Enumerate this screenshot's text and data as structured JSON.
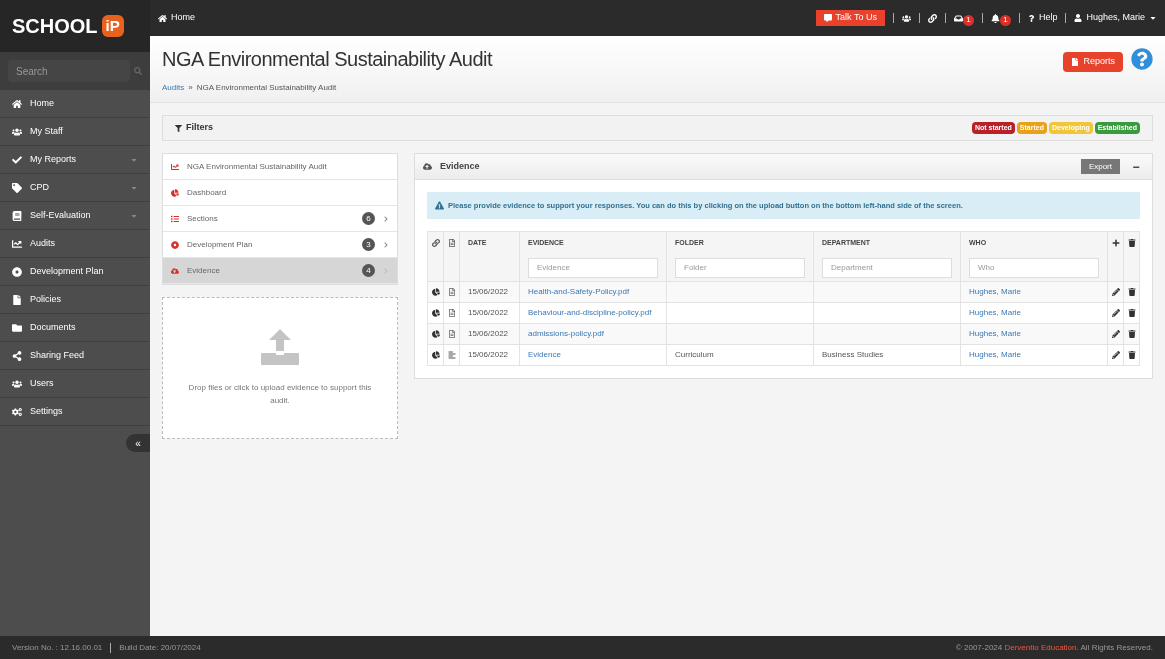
{
  "brand": {
    "name": "SCHOOL",
    "mark": "iP"
  },
  "topbar": {
    "home": "Home",
    "talk": "Talk To Us",
    "messages_count": "1",
    "alerts_count": "1",
    "help": "Help",
    "user": "Hughes, Marie"
  },
  "sidebar": {
    "search_placeholder": "Search",
    "items": [
      {
        "label": "Home",
        "has_caret": false
      },
      {
        "label": "My Staff",
        "has_caret": false
      },
      {
        "label": "My Reports",
        "has_caret": true
      },
      {
        "label": "CPD",
        "has_caret": true
      },
      {
        "label": "Self-Evaluation",
        "has_caret": true
      },
      {
        "label": "Audits",
        "has_caret": false
      },
      {
        "label": "Development Plan",
        "has_caret": false
      },
      {
        "label": "Policies",
        "has_caret": false
      },
      {
        "label": "Documents",
        "has_caret": false
      },
      {
        "label": "Sharing Feed",
        "has_caret": false
      },
      {
        "label": "Users",
        "has_caret": false
      },
      {
        "label": "Settings",
        "has_caret": false
      }
    ],
    "collapse": "«"
  },
  "page": {
    "title": "NGA Environmental Sustainability Audit",
    "breadcrumb": {
      "link": "Audits",
      "sep": "»",
      "current": "NGA Environmental Sustainability Audit"
    },
    "reports": "Reports"
  },
  "filters": {
    "title": "Filters",
    "legend": [
      {
        "label": "Not started",
        "color": "#b8202a"
      },
      {
        "label": "Started",
        "color": "#e8a21a"
      },
      {
        "label": "Developing",
        "color": "#f0c53a"
      },
      {
        "label": "Established",
        "color": "#3a9a3e"
      }
    ]
  },
  "nav": [
    {
      "label": "NGA Environmental Sustainability Audit",
      "selected": false
    },
    {
      "label": "Dashboard",
      "selected": false
    },
    {
      "label": "Sections",
      "count": "6",
      "selected": false
    },
    {
      "label": "Development Plan",
      "count": "3",
      "selected": false
    },
    {
      "label": "Evidence",
      "count": "4",
      "selected": true
    }
  ],
  "upload": {
    "text": "Drop files or click to upload evidence to support this audit."
  },
  "evidence": {
    "title": "Evidence",
    "export": "Export",
    "collapse": "−",
    "notice": "Please provide evidence to support your responses. You can do this by clicking on the upload button on the bottom left-hand side of the screen.",
    "columns": [
      "DATE",
      "EVIDENCE",
      "FOLDER",
      "DEPARTMENT",
      "WHO"
    ],
    "filter_fields": [
      {
        "placeholder": "Evidence"
      },
      {
        "placeholder": "Folder"
      },
      {
        "placeholder": "Department"
      },
      {
        "placeholder": "Who"
      }
    ],
    "rows": [
      {
        "kind": "file",
        "date": "15/06/2022",
        "evidence": "Health-and-Safety-Policy.pdf",
        "who": "Hughes, Marie"
      },
      {
        "kind": "file",
        "date": "15/06/2022",
        "evidence": "Behaviour-and-discipline-policy.pdf",
        "who": "Hughes, Marie"
      },
      {
        "kind": "file",
        "date": "15/06/2022",
        "evidence": "admissions-policy.pdf",
        "who": "Hughes, Marie"
      },
      {
        "kind": "note",
        "date": "15/06/2022",
        "evidence": "Evidence",
        "folder": "Curriculum",
        "department": "Business Studies",
        "who": "Hughes, Marie"
      }
    ]
  },
  "footer": {
    "version": "Version No. : 12.16.00.01",
    "build": "Build Date: 20/07/2024",
    "copyright": "© 2007-2024",
    "company": "Derventio Education",
    "rights": ". All Rights Reserved."
  }
}
